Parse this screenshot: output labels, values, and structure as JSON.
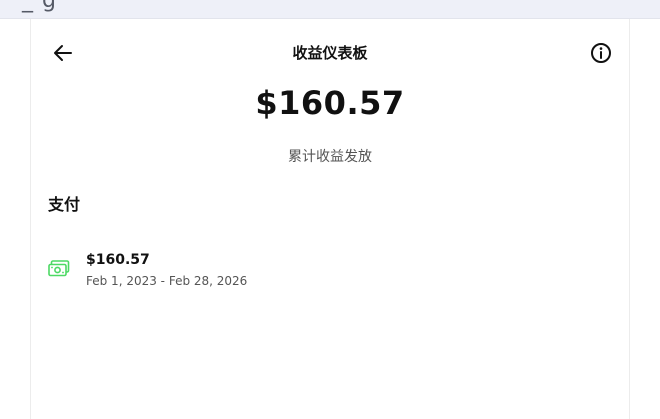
{
  "browser": {
    "partial_text": "_  g"
  },
  "header": {
    "title": "收益仪表板",
    "back_icon": "arrow-left-icon",
    "info_icon": "info-circle-icon"
  },
  "summary": {
    "amount": "$160.57",
    "caption": "累计收益发放"
  },
  "payments": {
    "heading": "支付",
    "items": [
      {
        "icon": "money-icon",
        "icon_color": "#4cd964",
        "amount": "$160.57",
        "period": "Feb 1, 2023 - Feb 28, 2026"
      }
    ]
  }
}
